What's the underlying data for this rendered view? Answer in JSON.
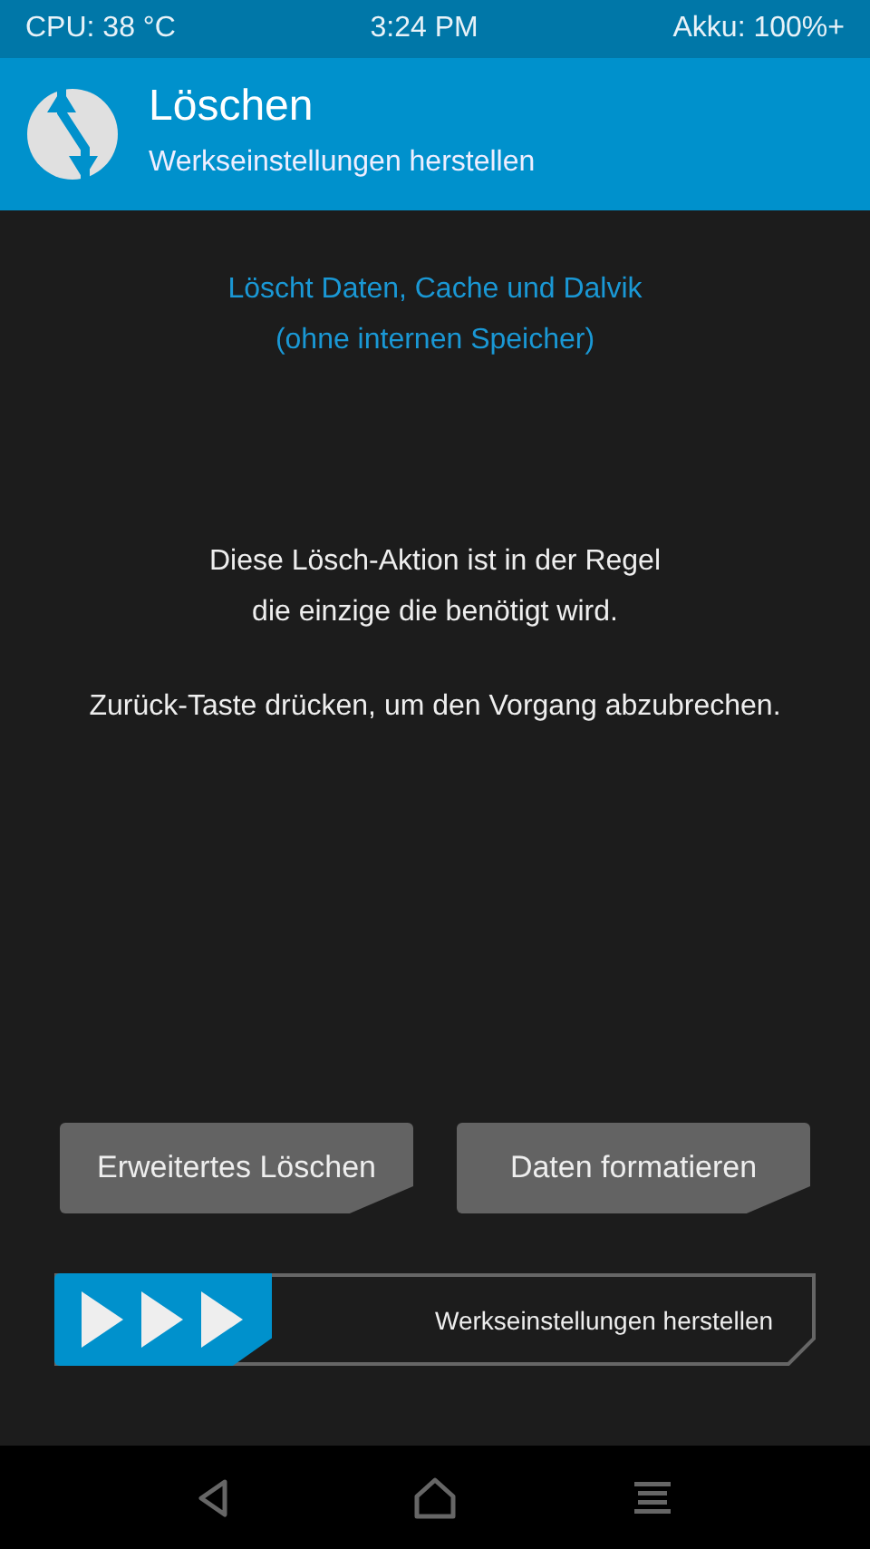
{
  "status_bar": {
    "cpu": "CPU: 38 °C",
    "time": "3:24 PM",
    "battery": "Akku: 100%+"
  },
  "header": {
    "title": "Löschen",
    "subtitle": "Werkseinstellungen herstellen"
  },
  "info": [
    "Löscht Daten, Cache und Dalvik",
    "(ohne internen Speicher)"
  ],
  "paragraphs": [
    [
      "Diese Lösch-Aktion ist in der Regel",
      "die einzige die benötigt wird."
    ],
    [
      "Zurück-Taste drücken, um den Vorgang abzubrechen."
    ]
  ],
  "buttons": [
    "Erweitertes Löschen",
    "Daten formatieren"
  ],
  "swipe": {
    "label": "Werkseinstellungen herstellen",
    "level": 0
  },
  "nav": [
    {
      "kind": "back"
    },
    {
      "kind": "home"
    },
    {
      "kind": "menu"
    }
  ]
}
